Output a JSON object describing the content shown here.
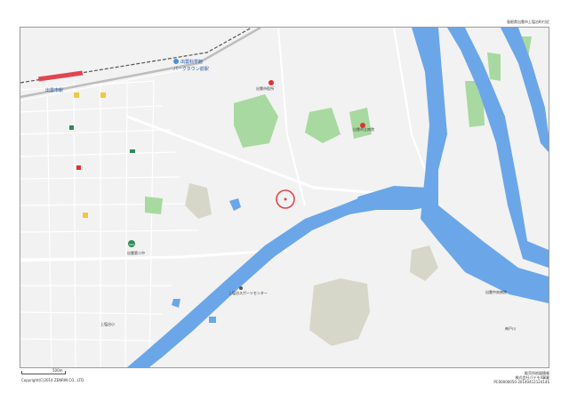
{
  "header": {
    "top_right": "島根県出雲市上塩冶町付近"
  },
  "footer": {
    "copyright": "Copyright(C)2014 ZENRIN CO., LTD.",
    "scale_label": "500m",
    "credit_line1": "販売所地図情報",
    "credit_line2": "株式会社パデモ4事業",
    "credit_line3": "PC00000050-2014041212414S"
  },
  "map": {
    "station_label": "出雲市駅",
    "park_station_label_1": "出雲科学館",
    "park_station_label_2": "パークタウン前駅",
    "sports_center_label": "上塩冶スポーツセンター",
    "hospital_label": "出雲市役所",
    "small_label_1": "出雲市立病院",
    "small_label_2": "出雲中央病院",
    "small_label_3": "出雲第二中",
    "small_label_4": "上塩冶小",
    "river_label": "神戸川",
    "route_label": "184",
    "marker_color": "#e0464e",
    "water_color": "#6ba6e8",
    "park_color": "#a8d9a0"
  }
}
